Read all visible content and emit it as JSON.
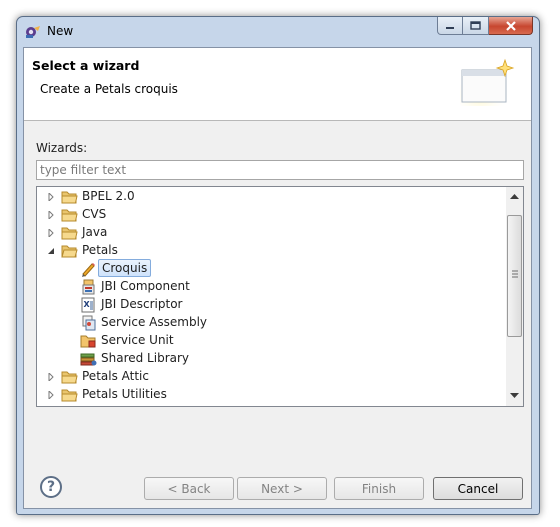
{
  "window": {
    "title": "New"
  },
  "header": {
    "title": "Select a wizard",
    "description": "Create a Petals croquis"
  },
  "wizards_label": "Wizards:",
  "filter": {
    "placeholder": "type filter text",
    "value": ""
  },
  "tree": {
    "items": [
      {
        "label": "BPEL 2.0",
        "icon": "folder-icon",
        "expanded": false
      },
      {
        "label": "CVS",
        "icon": "folder-icon",
        "expanded": false
      },
      {
        "label": "Java",
        "icon": "folder-icon",
        "expanded": false
      },
      {
        "label": "Petals",
        "icon": "folder-open-icon",
        "expanded": true
      },
      {
        "label": "Croquis",
        "icon": "pencil-icon",
        "selected": true
      },
      {
        "label": "JBI Component",
        "icon": "jbi-component-icon"
      },
      {
        "label": "JBI Descriptor",
        "icon": "xml-descriptor-icon"
      },
      {
        "label": "Service Assembly",
        "icon": "service-assembly-icon"
      },
      {
        "label": "Service Unit",
        "icon": "service-unit-icon"
      },
      {
        "label": "Shared Library",
        "icon": "shared-library-icon"
      },
      {
        "label": "Petals Attic",
        "icon": "folder-icon",
        "expanded": false
      },
      {
        "label": "Petals Utilities",
        "icon": "folder-icon",
        "expanded": false
      }
    ]
  },
  "buttons": {
    "back": "< Back",
    "next": "Next >",
    "finish": "Finish",
    "cancel": "Cancel",
    "help": "?"
  },
  "colors": {
    "title_bar": "#c6d6ea",
    "close_button": "#c7462f",
    "selection": "#cfe3fb"
  }
}
